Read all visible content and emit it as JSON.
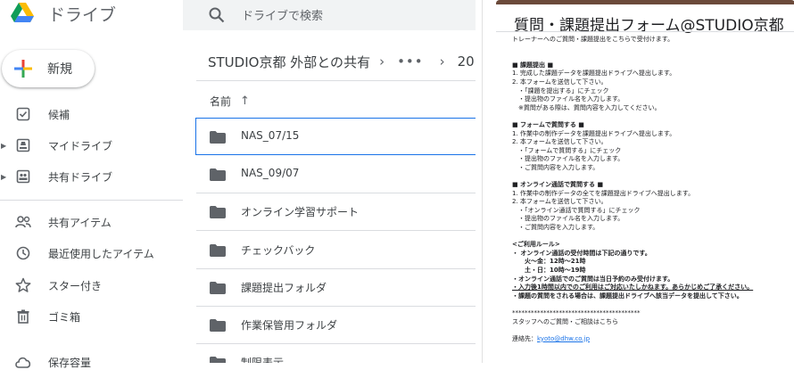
{
  "nav": {
    "app_name": "ドライブ",
    "new_label": "新規",
    "items": [
      {
        "label": "候補",
        "icon": "check-square-icon"
      },
      {
        "label": "マイドライブ",
        "icon": "my-drive-icon"
      },
      {
        "label": "共有ドライブ",
        "icon": "shared-drive-icon"
      },
      {
        "label": "共有アイテム",
        "icon": "people-icon"
      },
      {
        "label": "最近使用したアイテム",
        "icon": "clock-icon"
      },
      {
        "label": "スター付き",
        "icon": "star-icon"
      },
      {
        "label": "ゴミ箱",
        "icon": "trash-icon"
      },
      {
        "label": "保存容量",
        "icon": "cloud-icon"
      }
    ]
  },
  "search": {
    "placeholder": "ドライブで検索"
  },
  "breadcrumb": {
    "parent": "STUDIO京都 外部との共有",
    "more": "•••",
    "current": "20"
  },
  "list": {
    "sort_label": "名前",
    "sort_arrow": "↑",
    "folders": [
      "NAS_07/15",
      "NAS_09/07",
      "オンライン学習サポート",
      "チェックバック",
      "課題提出フォルダ",
      "作業保管用フォルダ",
      "制限表示"
    ]
  },
  "form": {
    "accent": "#6b4a3a",
    "title": "質問・課題提出フォーム@STUDIO京都",
    "lines": [
      {
        "t": "トレーナーへのご質問・課題提出をこちらで受付けます。",
        "s": ""
      },
      {
        "t": "",
        "s": ""
      },
      {
        "t": "",
        "s": ""
      },
      {
        "t": "■ 課題提出 ■",
        "s": "b"
      },
      {
        "t": "1. 完成した課題データを課題提出ドライブへ提出します。",
        "s": ""
      },
      {
        "t": "2. 本フォームを送信して下さい。",
        "s": ""
      },
      {
        "t": "　・「課題を提出する」にチェック",
        "s": ""
      },
      {
        "t": "　・提出物のファイル名を入力します。",
        "s": ""
      },
      {
        "t": "　※質問がある際は、質問内容を入力してください。",
        "s": ""
      },
      {
        "t": "",
        "s": ""
      },
      {
        "t": "■ フォームで質問する ■",
        "s": "b"
      },
      {
        "t": "1. 作業中の制作データを課題提出ドライブへ提出します。",
        "s": ""
      },
      {
        "t": "2. 本フォームを送信して下さい。",
        "s": ""
      },
      {
        "t": "　・「フォームで質問する」にチェック",
        "s": ""
      },
      {
        "t": "　・提出物のファイル名を入力します。",
        "s": ""
      },
      {
        "t": "　・ご質問内容を入力します。",
        "s": ""
      },
      {
        "t": "",
        "s": ""
      },
      {
        "t": "■ オンライン通話で質問する ■",
        "s": "b"
      },
      {
        "t": "1. 作業中の制作データの全てを課題提出ドライブへ提出します。",
        "s": ""
      },
      {
        "t": "2. 本フォームを送信して下さい。",
        "s": ""
      },
      {
        "t": "　・「オンライン通話で質問する」にチェック",
        "s": ""
      },
      {
        "t": "　・提出物のファイル名を入力します。",
        "s": ""
      },
      {
        "t": "　・ご質問内容を入力します。",
        "s": ""
      },
      {
        "t": "",
        "s": ""
      },
      {
        "t": "<ご利用ルール>",
        "s": "b"
      },
      {
        "t": "・ オンライン通話の受付時間は下記の通りです。",
        "s": "b"
      },
      {
        "t": "　　火〜金：12時〜21時",
        "s": "b"
      },
      {
        "t": "　　土・日：10時〜19時",
        "s": "b"
      },
      {
        "t": "・オンライン通話でのご質問は当日予約のみ受付けます。",
        "s": "b"
      },
      {
        "t": "・入力後1時間以内でのご利用はご対応いたしかねます。あらかじめご了承ください。",
        "s": "u"
      },
      {
        "t": "・課題の質問をされる場合は、課題提出ドライブへ該当データを提出して下さい。",
        "s": "b"
      },
      {
        "t": "",
        "s": ""
      },
      {
        "t": "*****************************************",
        "s": ""
      },
      {
        "t": "スタッフへのご質問・ご相談はこちら",
        "s": ""
      },
      {
        "t": "",
        "s": ""
      },
      {
        "t": "連絡先：",
        "s": "",
        "link": "kyoto@dhw.co.jp"
      }
    ]
  }
}
